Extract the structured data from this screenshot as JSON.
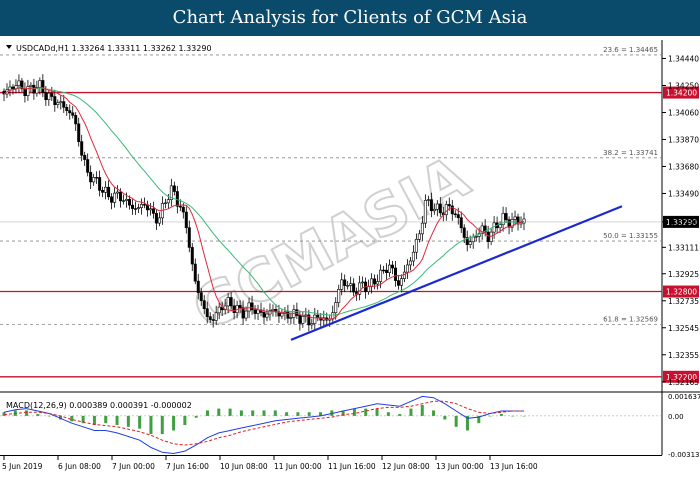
{
  "header": {
    "title": "Chart Analysis for Clients of GCM Asia"
  },
  "chart_data": {
    "type": "candlestick",
    "symbol_info": "USDCADd,H1  1.33264 1.33311 1.33262 1.33290",
    "watermark": "GCMASIA",
    "price_axis": {
      "range": [
        1.321,
        1.3457
      ],
      "ticks": [
        "1.34440",
        "1.34250",
        "1.34060",
        "1.33870",
        "1.33680",
        "1.33490",
        "1.33290",
        "1.33111",
        "1.32925",
        "1.32735",
        "1.32545",
        "1.32355",
        "1.32165"
      ],
      "current_price": "1.33290"
    },
    "time_axis": [
      "5 Jun 2019",
      "6 Jun 08:00",
      "7 Jun 00:00",
      "7 Jun 16:00",
      "10 Jun 08:00",
      "11 Jun 00:00",
      "11 Jun 16:00",
      "12 Jun 08:00",
      "13 Jun 00:00",
      "13 Jun 16:00"
    ],
    "support_resistance": [
      {
        "price": 1.342,
        "label": "1.34200"
      },
      {
        "price": 1.328,
        "label": "1.32800"
      },
      {
        "price": 1.322,
        "label": "1.32200"
      }
    ],
    "fibonacci": [
      {
        "price": 1.34465,
        "label": "23.6 = 1.34465"
      },
      {
        "price": 1.33741,
        "label": "38.2 = 1.33741"
      },
      {
        "price": 1.33155,
        "label": "50.0 = 1.33155"
      },
      {
        "price": 1.32569,
        "label": "61.8 = 1.32569"
      }
    ],
    "trendline": [
      {
        "x": 0.51,
        "price": 1.3246
      },
      {
        "x": 1.0,
        "price": 1.334
      }
    ],
    "close_path": [
      1.3419,
      1.3424,
      1.3426,
      1.3421,
      1.3423,
      1.3425,
      1.3418,
      1.3415,
      1.3412,
      1.3408,
      1.3402,
      1.3378,
      1.3362,
      1.3358,
      1.3352,
      1.3346,
      1.3348,
      1.3345,
      1.334,
      1.3338,
      1.3342,
      1.3335,
      1.333,
      1.3345,
      1.3352,
      1.334,
      1.3326,
      1.329,
      1.3275,
      1.326,
      1.3262,
      1.327,
      1.3272,
      1.3268,
      1.3265,
      1.3269,
      1.3266,
      1.3263,
      1.3267,
      1.3265,
      1.3263,
      1.3264,
      1.3262,
      1.326,
      1.3259,
      1.3263,
      1.3258,
      1.3268,
      1.3288,
      1.3284,
      1.328,
      1.3285,
      1.3283,
      1.3289,
      1.3294,
      1.3299,
      1.3284,
      1.3293,
      1.3305,
      1.3318,
      1.3343,
      1.334,
      1.3336,
      1.3339,
      1.3337,
      1.3326,
      1.3312,
      1.3319,
      1.3324,
      1.3318,
      1.3327,
      1.3331,
      1.3329,
      1.333,
      1.3329
    ],
    "macd": {
      "label": "MACD(12,26,9) 0.000389 0.000391 -0.000002",
      "ticks": [
        "0.001637",
        "0.00",
        "-0.003138"
      ],
      "range": [
        -0.003138,
        0.001637
      ],
      "main": [
        0.0003,
        0.0005,
        0.0006,
        0.0004,
        0.0002,
        -0.0002,
        -0.0006,
        -0.0009,
        -0.0012,
        -0.0012,
        -0.0014,
        -0.0017,
        -0.002,
        -0.0026,
        -0.003,
        -0.0031,
        -0.0029,
        -0.0024,
        -0.0018,
        -0.0014,
        -0.0012,
        -0.001,
        -0.0008,
        -0.0006,
        -0.0004,
        -0.0003,
        -0.0002,
        -0.0001,
        0.0,
        0.0002,
        0.0004,
        0.0006,
        0.0008,
        0.001,
        0.0009,
        0.0008,
        0.0012,
        0.0016,
        0.0015,
        0.001,
        0.0004,
        -0.0002,
        -0.0001,
        0.0002,
        0.0004,
        0.0004,
        0.0004
      ],
      "signal": [
        0.0001,
        0.0002,
        0.0003,
        0.0003,
        0.0002,
        0.0,
        -0.0003,
        -0.0005,
        -0.0007,
        -0.0008,
        -0.0009,
        -0.0011,
        -0.0013,
        -0.0016,
        -0.002,
        -0.0023,
        -0.0024,
        -0.0023,
        -0.0021,
        -0.0018,
        -0.0016,
        -0.0013,
        -0.0011,
        -0.0009,
        -0.0007,
        -0.0005,
        -0.0004,
        -0.0003,
        -0.0002,
        -0.0001,
        0.0001,
        0.0002,
        0.0004,
        0.0006,
        0.0007,
        0.0007,
        0.0008,
        0.001,
        0.0012,
        0.0012,
        0.001,
        0.0006,
        0.0003,
        0.0002,
        0.0003,
        0.0004,
        0.0004
      ]
    },
    "colors": {
      "candle": "#000000",
      "sr_line": "#c8102e",
      "ma_fast": "#e0283c",
      "ma_slow": "#3cb878",
      "trendline": "#1a2ad0",
      "macd_main": "#2040e0",
      "macd_signal": "#e02020",
      "macd_hist": "#40a040",
      "header_bg": "#0a4a6b"
    }
  }
}
